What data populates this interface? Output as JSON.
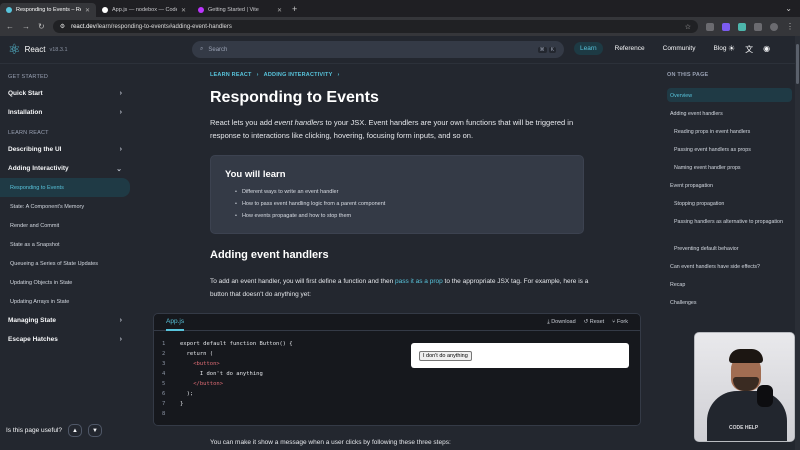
{
  "browser": {
    "tabs": [
      {
        "title": "Responding to Events – React",
        "active": true,
        "favicon_color": "#58c4dc"
      },
      {
        "title": "App.js — nodebox — CodeSandbox",
        "active": false,
        "favicon_color": "#ffffff"
      },
      {
        "title": "Getting Started | Vite",
        "active": false,
        "favicon_color": "#bd34fe"
      }
    ],
    "url_host": "react.dev",
    "url_path": "/learn/responding-to-events#adding-event-handlers"
  },
  "header": {
    "logo_text": "React",
    "version": "v18.3.1",
    "search_placeholder": "Search",
    "search_shortcut": [
      "⌘",
      "K"
    ],
    "nav": [
      "Learn",
      "Reference",
      "Community",
      "Blog"
    ],
    "active_nav": "Learn"
  },
  "sidebar": {
    "section_get_started": "GET STARTED",
    "get_started_items": [
      "Quick Start",
      "Installation"
    ],
    "section_learn": "LEARN REACT",
    "top_items": [
      "Describing the UI",
      "Adding Interactivity"
    ],
    "sub_items": [
      "Responding to Events",
      "State: A Component's Memory",
      "Render and Commit",
      "State as a Snapshot",
      "Queueing a Series of State Updates",
      "Updating Objects in State",
      "Updating Arrays in State"
    ],
    "active_sub": "Responding to Events",
    "bottom_items": [
      "Managing State",
      "Escape Hatches"
    ],
    "feedback_question": "Is this page useful?"
  },
  "main": {
    "breadcrumbs": [
      "LEARN REACT",
      "ADDING INTERACTIVITY"
    ],
    "title": "Responding to Events",
    "intro_before": "React lets you add ",
    "intro_em": "event handlers",
    "intro_after": " to your JSX. Event handlers are your own functions that will be triggered in response to interactions like clicking, hovering, focusing form inputs, and so on.",
    "you_will_learn": {
      "heading": "You will learn",
      "items": [
        "Different ways to write an event handler",
        "How to pass event handling logic from a parent component",
        "How events propagate and how to stop them"
      ]
    },
    "section_heading": "Adding event handlers",
    "para_before": "To add an event handler, you will first define a function and then ",
    "para_link": "pass it as a prop",
    "para_after": " to the appropriate JSX tag. For example, here is a button that doesn't do anything yet:",
    "sandpack": {
      "file": "App.js",
      "actions": [
        "Download",
        "Reset",
        "Fork"
      ],
      "code_lines": [
        "export default function Button() {",
        "  return (",
        "    <button>",
        "      I don't do anything",
        "    </button>",
        "  );",
        "}",
        ""
      ],
      "preview_button": "I don't do anything"
    },
    "next_para": "You can make it show a message when a user clicks by following these three steps:"
  },
  "toc": {
    "heading": "ON THIS PAGE",
    "items": [
      {
        "label": "Overview",
        "level": 0,
        "active": true
      },
      {
        "label": "Adding event handlers",
        "level": 0
      },
      {
        "label": "Reading props in event handlers",
        "level": 1
      },
      {
        "label": "Passing event handlers as props",
        "level": 1
      },
      {
        "label": "Naming event handler props",
        "level": 1
      },
      {
        "label": "Event propagation",
        "level": 0
      },
      {
        "label": "Stopping propagation",
        "level": 1
      },
      {
        "label": "Passing handlers as alternative to propagation",
        "level": 1
      },
      {
        "label": "Preventing default behavior",
        "level": 1
      },
      {
        "label": "Can event handlers have side effects?",
        "level": 0
      },
      {
        "label": "Recap",
        "level": 0
      },
      {
        "label": "Challenges",
        "level": 0
      }
    ]
  },
  "webcam": {
    "brand": "CODE HELP"
  }
}
